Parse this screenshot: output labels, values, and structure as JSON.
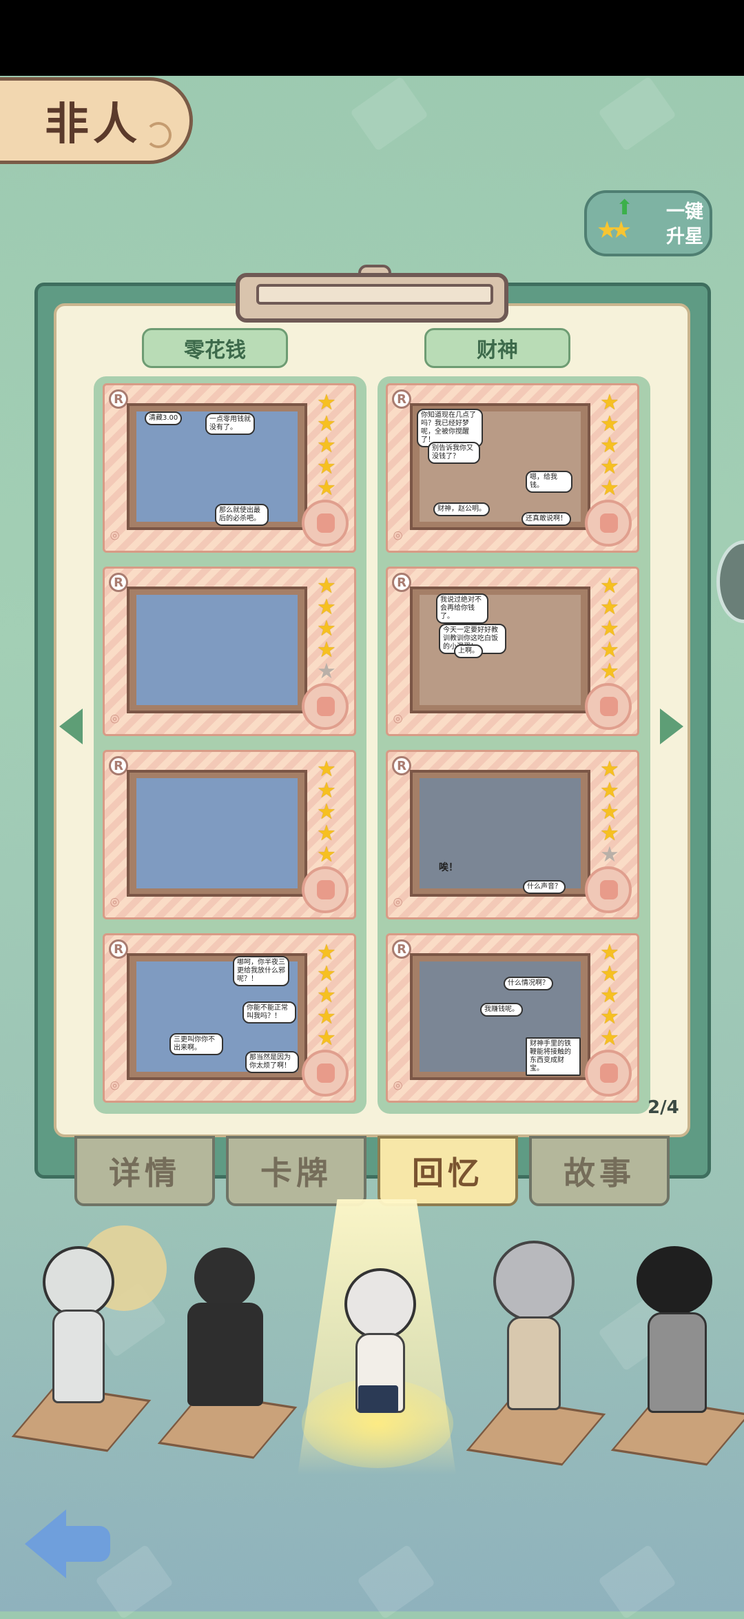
{
  "header": {
    "title": "非人"
  },
  "upgrade_button": {
    "label_line1": "一键",
    "label_line2": "升星"
  },
  "columns": [
    {
      "label": "零花钱",
      "cards": [
        {
          "stars": 5,
          "bubbles": [
            "清藏3.00",
            "一点零用钱就没有了。",
            "那么就使出最后的必杀吧。"
          ]
        },
        {
          "stars": 4,
          "bubbles": []
        },
        {
          "stars": 5,
          "bubbles": []
        },
        {
          "stars": 5,
          "bubbles": [
            "哪呵，你半夜三更给我放什么邪呢？！",
            "你能不能正常叫我吗？！",
            "三更叫你你不出来啊。",
            "那当然是因为你太烦了啊！"
          ]
        }
      ]
    },
    {
      "label": "财神",
      "cards": [
        {
          "stars": 5,
          "bubbles": [
            "你知道现在几点了吗？我已经好梦呢，全被你搅醒了！",
            "别告诉我你又没钱了？",
            "嗯，给我钱。",
            "财神，赵公明。",
            "还真敢说啊！"
          ]
        },
        {
          "stars": 5,
          "bubbles": [
            "我说过绝对不会再给你钱了。",
            "今天一定要好好教训教训你这吃白饭的小混蛋！",
            "上啊。"
          ]
        },
        {
          "stars": 4,
          "bubbles": [
            "什么声音？",
            "唉！"
          ]
        },
        {
          "stars": 5,
          "bubbles": [
            "什么情况啊？",
            "我赚钱呢。",
            "财神手里的铁鞭能将接触的东西变成财宝。"
          ]
        }
      ]
    }
  ],
  "pagination": {
    "current": "2/4"
  },
  "tabs": [
    "详情",
    "卡牌",
    "回忆",
    "故事"
  ],
  "active_tab": "回忆",
  "characters": [
    "char-1",
    "char-2",
    "char-3-selected",
    "char-4",
    "char-5"
  ]
}
